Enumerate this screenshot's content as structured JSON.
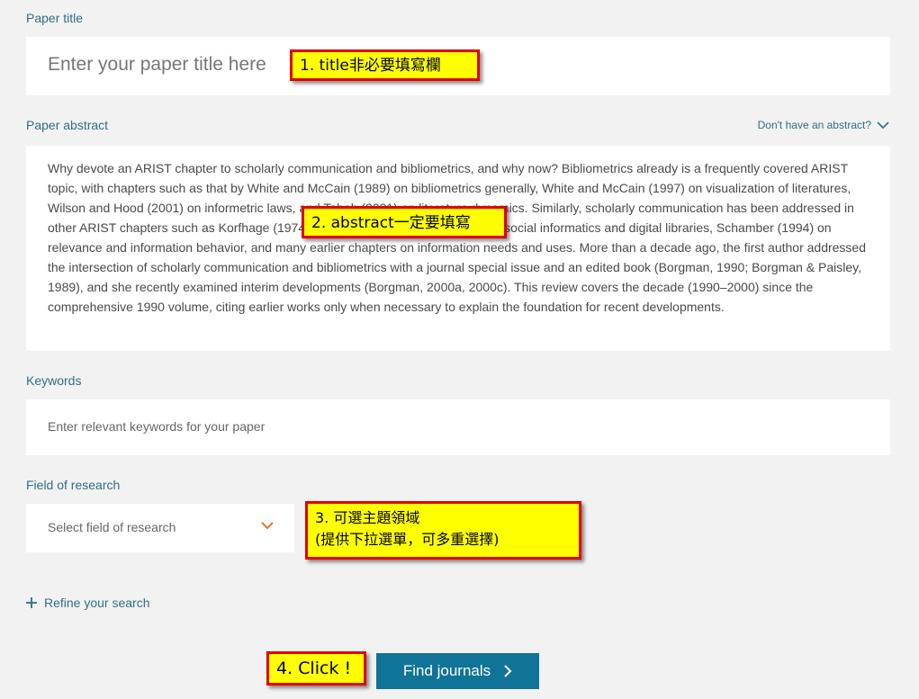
{
  "paper_title": {
    "label": "Paper title",
    "placeholder": "Enter your paper title here"
  },
  "paper_abstract": {
    "label": "Paper abstract",
    "no_abstract_link": "Don't have an abstract?",
    "text": "Why devote an ARIST chapter to scholarly communication and bibliometrics, and why now? Bibliometrics already is a frequently covered ARIST topic, with chapters such as that by White and McCain (1989) on bibliometrics generally, White and McCain (1997) on visualization of literatures, Wilson and Hood (2001) on informetric laws, and Tabah (2001) on literature dynamics. Similarly, scholarly communication has been addressed in other ARIST chapters such as Korfhage (1974) and Kling and Callahan (2003) on social informatics and digital libraries, Schamber (1994) on relevance and information behavior, and many earlier chapters on information needs and uses. More than a decade ago, the first author addressed the intersection of scholarly communication and bibliometrics with a journal special issue and an edited book (Borgman, 1990; Borgman & Paisley, 1989), and she recently examined interim developments (Borgman, 2000a, 2000c). This review covers the decade (1990–2000) since the comprehensive 1990 volume, citing earlier works only when necessary to explain the foundation for recent developments."
  },
  "keywords": {
    "label": "Keywords",
    "placeholder": "Enter relevant keywords for your paper"
  },
  "field_of_research": {
    "label": "Field of research",
    "placeholder": "Select field of research"
  },
  "refine_label": "Refine your search",
  "find_button_label": "Find journals",
  "annotations": {
    "note1": "1. title非必要填寫欄",
    "note2": "2. abstract一定要填寫",
    "note3_line1": "3. 可選主題領域",
    "note3_line2": "(提供下拉選單，可多重選擇)",
    "note4": "4. Click !"
  },
  "colors": {
    "accent": "#2f6f86",
    "button": "#0f7497",
    "chevron": "#e8732a",
    "note_bg": "#ffff00",
    "note_border": "#e00000",
    "page_bg": "#f2f2f2"
  },
  "icons": {
    "abstract_toggle": "chevron-down-icon",
    "field_select": "chevron-down-icon",
    "refine": "plus-icon",
    "find_button": "chevron-right-icon"
  }
}
